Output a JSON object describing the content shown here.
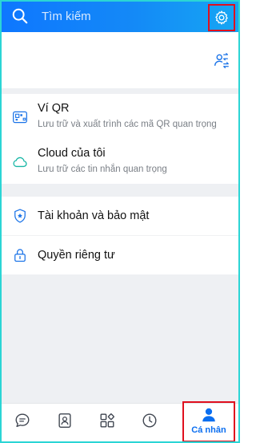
{
  "search": {
    "placeholder": "Tìm kiếm"
  },
  "menu": {
    "qr_wallet": {
      "title": "Ví QR",
      "subtitle": "Lưu trữ và xuất trình các mã QR quan trọng"
    },
    "my_cloud": {
      "title": "Cloud của tôi",
      "subtitle": "Lưu trữ các tin nhắn quan trọng"
    },
    "account_security": {
      "title": "Tài khoản và bảo mật"
    },
    "privacy": {
      "title": "Quyền riêng tư"
    }
  },
  "bottom_nav": {
    "items": [
      "chat-icon",
      "contacts-icon",
      "discover-icon",
      "timeline-icon",
      "person-icon"
    ],
    "active_label": "Cá nhân"
  },
  "colors": {
    "header_start": "#0e77ff",
    "header_end": "#16a6f3",
    "accent": "#0a6ef0",
    "highlight": "#e0101e"
  }
}
